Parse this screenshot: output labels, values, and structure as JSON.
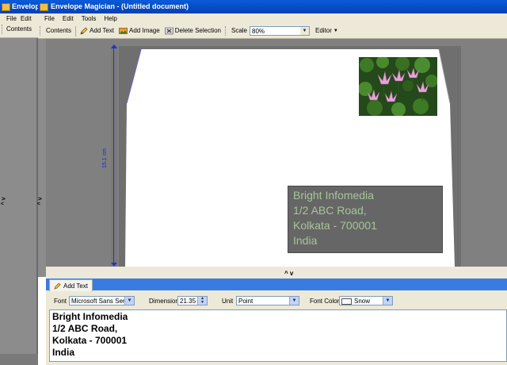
{
  "back_window": {
    "title": "Envelop",
    "menu": [
      "File",
      "Edit"
    ],
    "toolbar_contents": "Contents",
    "panel_handle": "^ v"
  },
  "window": {
    "title": "Envelope Magician - (Untitled document)"
  },
  "menu": [
    "File",
    "Edit",
    "Tools",
    "Help"
  ],
  "toolbar": {
    "contents": "Contents",
    "add_text": "Add Text",
    "add_image": "Add Image",
    "delete_selection": "Delete Selection",
    "scale_label": "Scale",
    "scale_value": "80%",
    "editor": "Editor"
  },
  "workspace": {
    "left_handle": "^ v",
    "dimension_label": "15.1 cm",
    "splitter_label": "^ v"
  },
  "envelope": {
    "address_lines": [
      "Bright Infomedia",
      "1/2 ABC Road,",
      "Kolkata - 700001",
      "India"
    ]
  },
  "panel": {
    "tab": "Add Text",
    "font_label": "Font",
    "font_value": "Microsoft Sans Serif",
    "dimension_label": "Dimension",
    "dimension_value": "21.35",
    "unit_label": "Unit",
    "unit_value": "Point",
    "font_color_label": "Font Color",
    "font_color_value": "Snow",
    "text_lines": [
      "Bright Infomedia",
      "1/2 ABC Road,",
      "Kolkata - 700001",
      "India"
    ]
  },
  "colors": {
    "titlebar": "#0a5bd8",
    "workspace": "#808080",
    "address_text": "#a7c59a",
    "dimension_line": "#2233cc"
  }
}
